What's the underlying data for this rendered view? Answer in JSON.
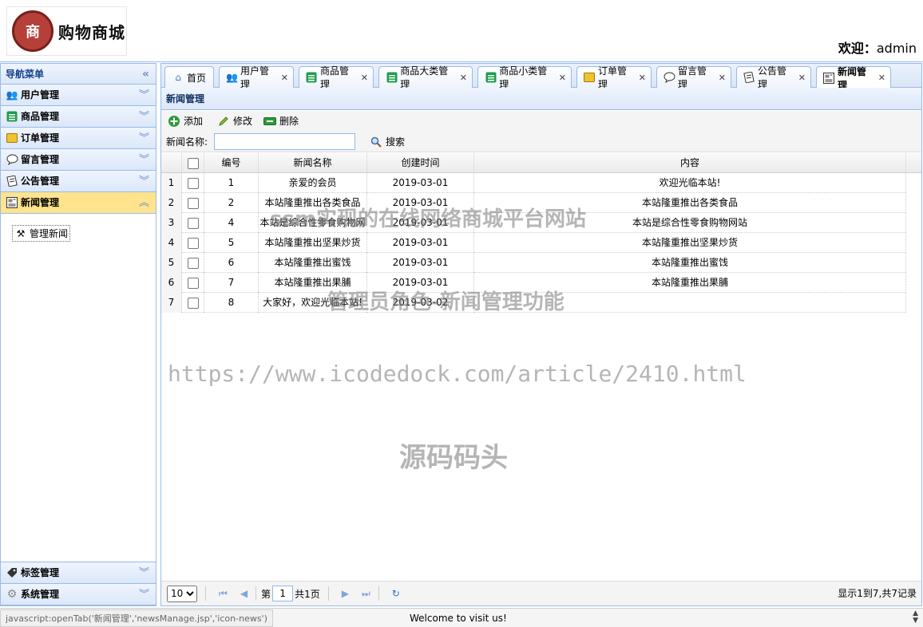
{
  "header": {
    "logo_text": "购物商城",
    "logo_emblem": "商",
    "welcome_label": "欢迎：",
    "welcome_user": "admin"
  },
  "nav": {
    "title": "导航菜单",
    "items": [
      {
        "label": "用户管理",
        "icon": "users-icon"
      },
      {
        "label": "商品管理",
        "icon": "list-icon"
      },
      {
        "label": "订单管理",
        "icon": "order-icon"
      },
      {
        "label": "留言管理",
        "icon": "comment-icon"
      },
      {
        "label": "公告管理",
        "icon": "notice-icon"
      },
      {
        "label": "新闻管理",
        "icon": "news-icon"
      }
    ],
    "sub_link": "管理新闻",
    "bottom_items": [
      {
        "label": "标签管理",
        "icon": "tag-icon"
      },
      {
        "label": "系统管理",
        "icon": "gear-icon"
      }
    ]
  },
  "tabs": [
    {
      "label": "首页",
      "icon": "home-icon"
    },
    {
      "label": "用户管理",
      "icon": "users-icon"
    },
    {
      "label": "商品管理",
      "icon": "list-icon"
    },
    {
      "label": "商品大类管理",
      "icon": "list-icon"
    },
    {
      "label": "商品小类管理",
      "icon": "list-icon"
    },
    {
      "label": "订单管理",
      "icon": "order-icon"
    },
    {
      "label": "留言管理",
      "icon": "comment-icon"
    },
    {
      "label": "公告管理",
      "icon": "notice-icon"
    },
    {
      "label": "新闻管理",
      "icon": "news-icon"
    }
  ],
  "panel": {
    "title": "新闻管理",
    "add_label": "添加",
    "edit_label": "修改",
    "delete_label": "删除",
    "search_label": "新闻名称:",
    "search_value": "",
    "search_button": "搜索"
  },
  "grid": {
    "columns": [
      "编号",
      "新闻名称",
      "创建时间",
      "内容"
    ],
    "rows": [
      {
        "n": "1",
        "id": "1",
        "name": "亲爱的会员",
        "date": "2019-03-01",
        "content": "欢迎光临本站!"
      },
      {
        "n": "2",
        "id": "2",
        "name": "本站隆重推出各类食品",
        "date": "2019-03-01",
        "content": "本站隆重推出各类食品"
      },
      {
        "n": "3",
        "id": "4",
        "name": "本站是综合性零食购物网",
        "date": "2019-03-01",
        "content": "本站是综合性零食购物网站"
      },
      {
        "n": "4",
        "id": "5",
        "name": "本站隆重推出坚果炒货",
        "date": "2019-03-01",
        "content": "本站隆重推出坚果炒货"
      },
      {
        "n": "5",
        "id": "6",
        "name": "本站隆重推出蜜饯",
        "date": "2019-03-01",
        "content": "本站隆重推出蜜饯"
      },
      {
        "n": "6",
        "id": "7",
        "name": "本站隆重推出果脯",
        "date": "2019-03-01",
        "content": "本站隆重推出果脯"
      },
      {
        "n": "7",
        "id": "8",
        "name": "大家好，欢迎光临本站!",
        "date": "2019-03-02",
        "content": ""
      }
    ]
  },
  "pager": {
    "page_size": "10",
    "page_prefix": "第",
    "page_value": "1",
    "page_total": "共1页",
    "info": "显示1到7,共7记录"
  },
  "statusbar": {
    "url": "javascript:openTab('新闻管理','newsManage.jsp','icon-news')",
    "welcome": "Welcome to visit us!"
  },
  "watermarks": {
    "line1": "ssm实现的在线网络商城平台网站",
    "line2": "管理员角色-新闻管理功能",
    "line3": "https://www.icodedock.com/article/2410.html",
    "line4": "源码码头"
  }
}
